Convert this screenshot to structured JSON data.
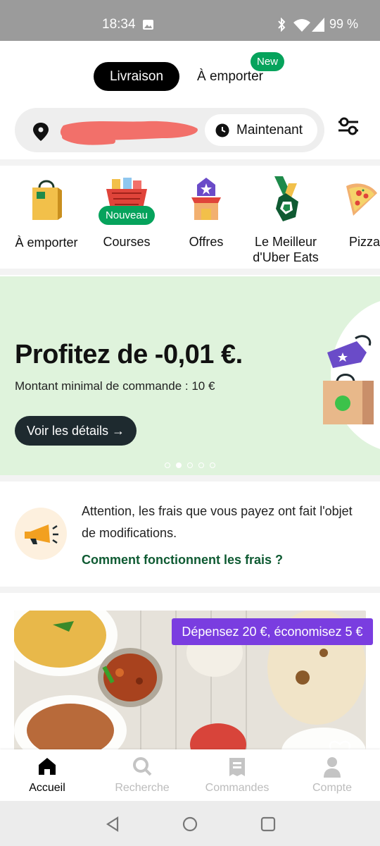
{
  "status_bar": {
    "time": "18:34",
    "battery": "99 %"
  },
  "mode_toggle": {
    "active": "Livraison",
    "other": "À emporter",
    "badge": "New"
  },
  "address_bar": {
    "time_option": "Maintenant"
  },
  "categories": [
    {
      "label": "À emporter"
    },
    {
      "label": "Courses",
      "badge": "Nouveau"
    },
    {
      "label": "Offres"
    },
    {
      "label": "Le Meilleur\nd'Uber Eats"
    },
    {
      "label": "Pizza"
    }
  ],
  "promo": {
    "title": "Profitez de -0,01 €.",
    "subtitle": "Montant minimal de commande : 10 €",
    "button": "Voir les détails →",
    "pages": 5,
    "active_page": 2,
    "background": "#dff3dc"
  },
  "notice": {
    "text": "Attention, les frais que vous payez ont fait l'objet de modifications.",
    "link": "Comment fonctionnent les frais ?"
  },
  "restaurant_card": {
    "deal_badge": "Dépensez 20 €, économisez 5 €"
  },
  "bottom_nav": [
    {
      "label": "Accueil",
      "icon": "home-icon",
      "active": true
    },
    {
      "label": "Recherche",
      "icon": "search-icon",
      "active": false
    },
    {
      "label": "Commandes",
      "icon": "receipt-icon",
      "active": false
    },
    {
      "label": "Compte",
      "icon": "person-icon",
      "active": false
    }
  ],
  "colors": {
    "brand_green": "#06a35c",
    "deal_purple": "#7a3de0",
    "link_green": "#0e5a32"
  }
}
